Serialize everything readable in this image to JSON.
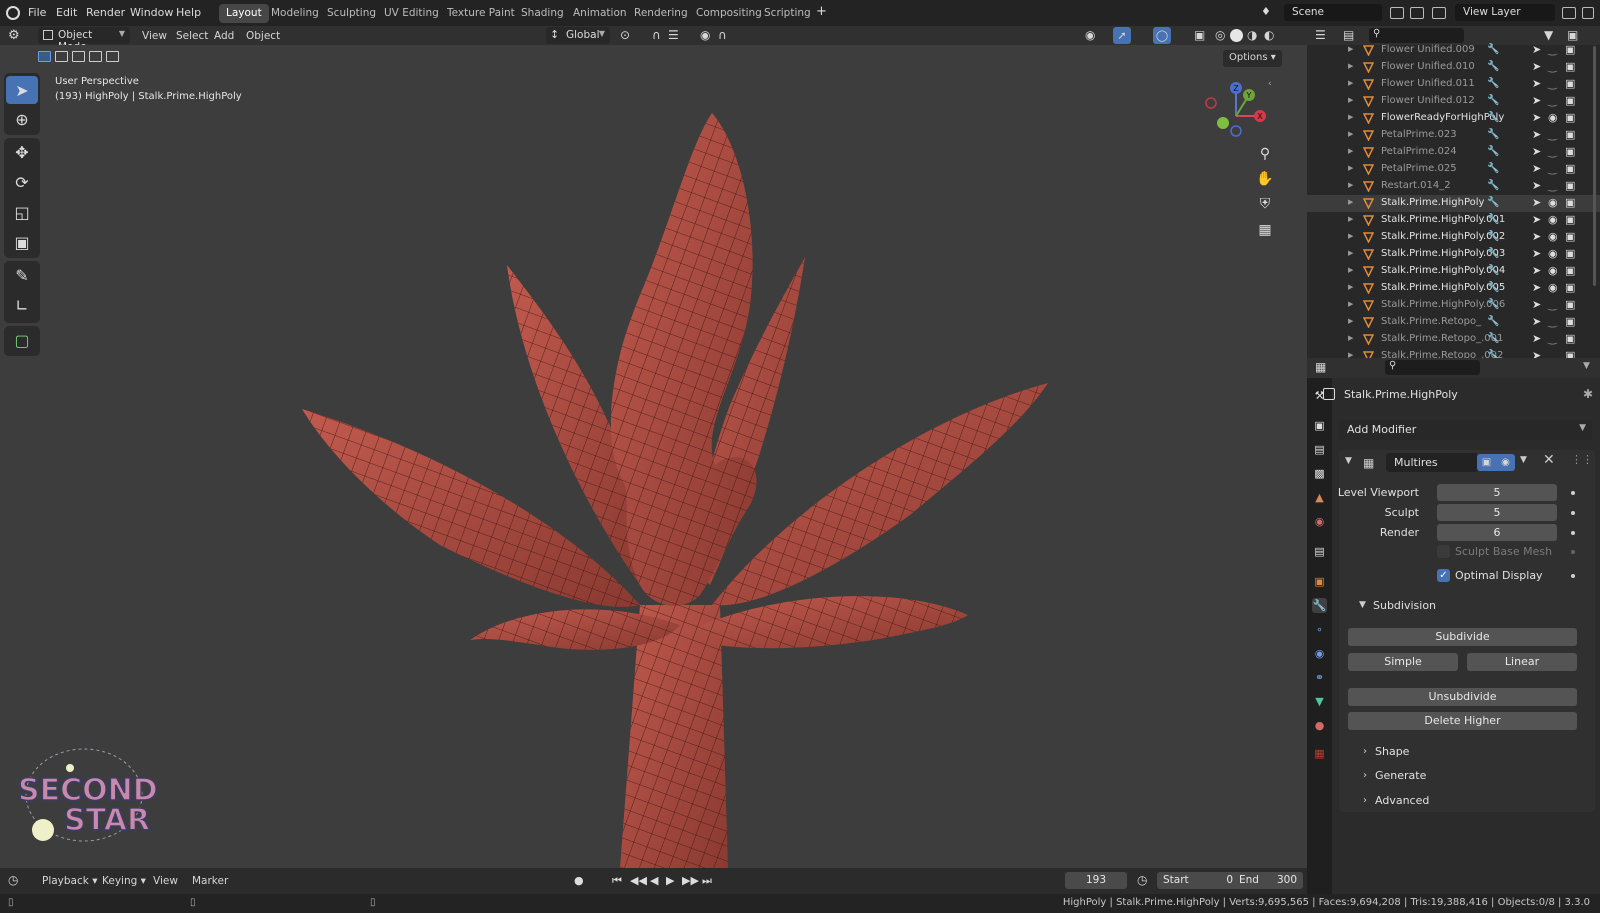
{
  "topbar": {
    "menus": [
      "File",
      "Edit",
      "Render",
      "Window",
      "Help"
    ],
    "workspaces": [
      "Layout",
      "Modeling",
      "Sculpting",
      "UV Editing",
      "Texture Paint",
      "Shading",
      "Animation",
      "Rendering",
      "Compositing",
      "Scripting"
    ],
    "active_workspace": "Layout",
    "add_tab": "+",
    "scene": "Scene",
    "view_layer": "View Layer"
  },
  "viewport_header": {
    "mode": "Object Mode",
    "menus": [
      "View",
      "Select",
      "Add",
      "Object"
    ],
    "orientation": "Global",
    "options": "Options"
  },
  "viewport": {
    "perspective": "User Perspective",
    "object_info": "(193) HighPoly | Stalk.Prime.HighPoly",
    "gizmo": {
      "x": "X",
      "y": "Y",
      "z": "Z"
    },
    "logo_text_line1": "SECOND",
    "logo_text_line2": "STAR"
  },
  "timeline": {
    "playback": "Playback",
    "keying": "Keying",
    "view": "View",
    "marker": "Marker",
    "current_frame": "193",
    "start_label": "Start",
    "start": "0",
    "end_label": "End",
    "end": "300"
  },
  "status": {
    "text": "HighPoly | Stalk.Prime.HighPoly | Verts:9,695,565 | Faces:9,694,208 | Tris:19,388,416 | Objects:0/8 | 3.3.0"
  },
  "outliner": {
    "rows": [
      {
        "name": "Flower Unified.009",
        "visible": false
      },
      {
        "name": "Flower Unified.010",
        "visible": false
      },
      {
        "name": "Flower Unified.011",
        "visible": false
      },
      {
        "name": "Flower Unified.012",
        "visible": false
      },
      {
        "name": "FlowerReadyForHighPoly",
        "visible": true
      },
      {
        "name": "PetalPrime.023",
        "visible": false
      },
      {
        "name": "PetalPrime.024",
        "visible": false
      },
      {
        "name": "PetalPrime.025",
        "visible": false
      },
      {
        "name": "Restart.014_2",
        "visible": false
      },
      {
        "name": "Stalk.Prime.HighPoly",
        "visible": true,
        "selected": true
      },
      {
        "name": "Stalk.Prime.HighPoly.001",
        "visible": true
      },
      {
        "name": "Stalk.Prime.HighPoly.002",
        "visible": true
      },
      {
        "name": "Stalk.Prime.HighPoly.003",
        "visible": true
      },
      {
        "name": "Stalk.Prime.HighPoly.004",
        "visible": true
      },
      {
        "name": "Stalk.Prime.HighPoly.005",
        "visible": true
      },
      {
        "name": "Stalk.Prime.HighPoly.006",
        "visible": false
      },
      {
        "name": "Stalk.Prime.Retopo_",
        "visible": false
      },
      {
        "name": "Stalk.Prime.Retopo_.001",
        "visible": false
      },
      {
        "name": "Stalk.Prime.Retopo_.002",
        "visible": false
      }
    ]
  },
  "properties": {
    "object_name": "Stalk.Prime.HighPoly",
    "add_modifier": "Add Modifier",
    "modifier_name": "Multires",
    "level_viewport_label": "Level Viewport",
    "level_viewport": "5",
    "sculpt_label": "Sculpt",
    "sculpt": "5",
    "render_label": "Render",
    "render": "6",
    "sculpt_base_mesh": "Sculpt Base Mesh",
    "optimal_display": "Optimal Display",
    "optimal_display_checked": true,
    "subdivision_label": "Subdivision",
    "subdivide": "Subdivide",
    "simple": "Simple",
    "linear": "Linear",
    "unsubdivide": "Unsubdivide",
    "delete_higher": "Delete Higher",
    "shape": "Shape",
    "generate": "Generate",
    "advanced": "Advanced"
  },
  "colors": {
    "accent_blue": "#4772b3",
    "mesh_red": "#a8473d",
    "viewport_bg": "#3d3d3d",
    "mesh_icon_orange": "#e08a3a"
  }
}
